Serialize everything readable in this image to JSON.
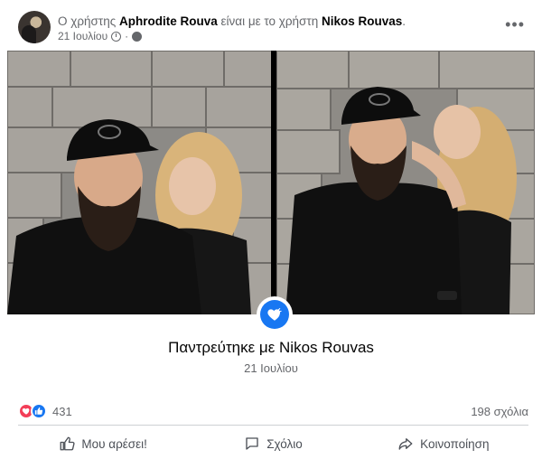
{
  "post": {
    "header_prefix": "Ο χρήστης",
    "author": "Aphrodite Rouva",
    "header_middle": "είναι με το χρήστη",
    "tagged": "Nikos Rouvas",
    "header_suffix": ".",
    "date": "21 Ιουλίου",
    "meta_separator": "·",
    "more_icon": "more-horizontal-icon",
    "privacy_icon": "globe-icon"
  },
  "life_event": {
    "icon": "heart-icon",
    "title": "Παντρεύτηκε με Nikos Rouvas",
    "date": "21 Ιουλίου"
  },
  "stats": {
    "reactions": [
      "love",
      "like"
    ],
    "reaction_count": "431",
    "comments": "198 σχόλια"
  },
  "actions": {
    "like": "Μου αρέσει!",
    "comment": "Σχόλιο",
    "share": "Κοινοποίηση"
  },
  "colors": {
    "accent": "#1877f2",
    "love": "#f33e58",
    "muted_text": "#65676b"
  }
}
